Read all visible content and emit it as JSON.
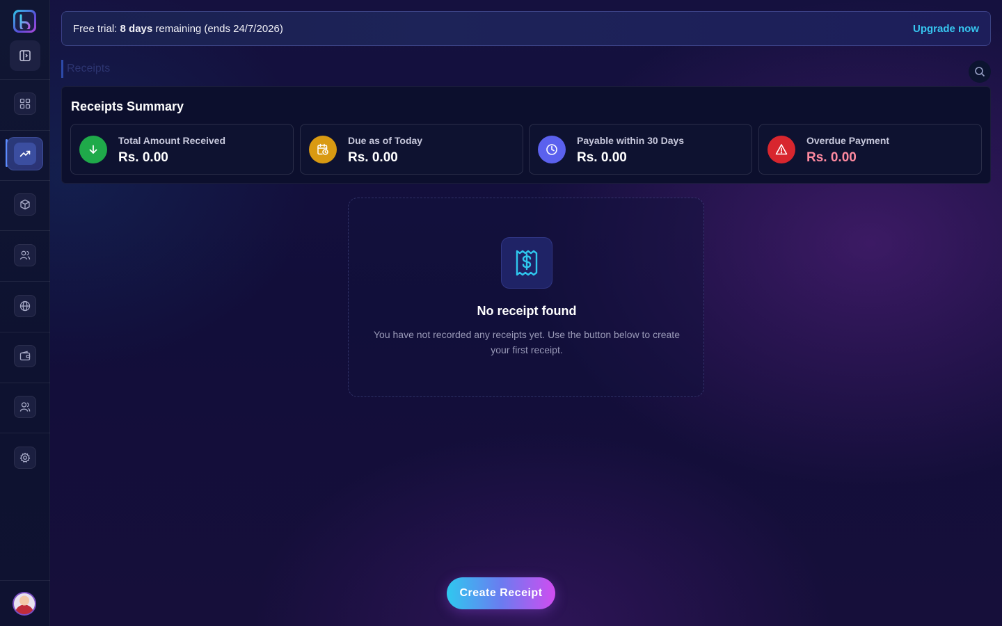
{
  "banner": {
    "prefix": "Free trial: ",
    "days": "8 days",
    "suffix": " remaining (ends 24/7/2026)",
    "upgrade_label": "Upgrade now"
  },
  "page": {
    "title": "Receipts"
  },
  "sidebar": {
    "items": [
      {
        "icon": "dashboard-grid-icon"
      },
      {
        "icon": "trending-up-icon",
        "active": true
      },
      {
        "icon": "package-box-icon"
      },
      {
        "icon": "users-icon"
      },
      {
        "icon": "globe-icon"
      },
      {
        "icon": "wallet-icon"
      },
      {
        "icon": "team-icon"
      },
      {
        "icon": "gear-icon"
      }
    ]
  },
  "summary": {
    "title": "Receipts Summary",
    "cards": [
      {
        "label": "Total Amount Received",
        "value": "Rs. 0.00",
        "icon": "arrow-down-icon",
        "color": "#1faa4a"
      },
      {
        "label": "Due as of Today",
        "value": "Rs. 0.00",
        "icon": "calendar-clock-icon",
        "color": "#d99a12"
      },
      {
        "label": "Payable within 30 Days",
        "value": "Rs. 0.00",
        "icon": "clock-icon",
        "color": "#5b61ee"
      },
      {
        "label": "Overdue Payment",
        "value": "Rs. 0.00",
        "icon": "warning-triangle-icon",
        "color": "#d8262e"
      }
    ]
  },
  "empty_state": {
    "icon": "receipt-dollar-icon",
    "title": "No receipt found",
    "description": "You have not recorded any receipts yet. Use the button below to create your first receipt."
  },
  "actions": {
    "create_label": "Create Receipt"
  },
  "colors": {
    "accent_cyan": "#37c6f0",
    "overdue_text": "#ff8aa0"
  }
}
